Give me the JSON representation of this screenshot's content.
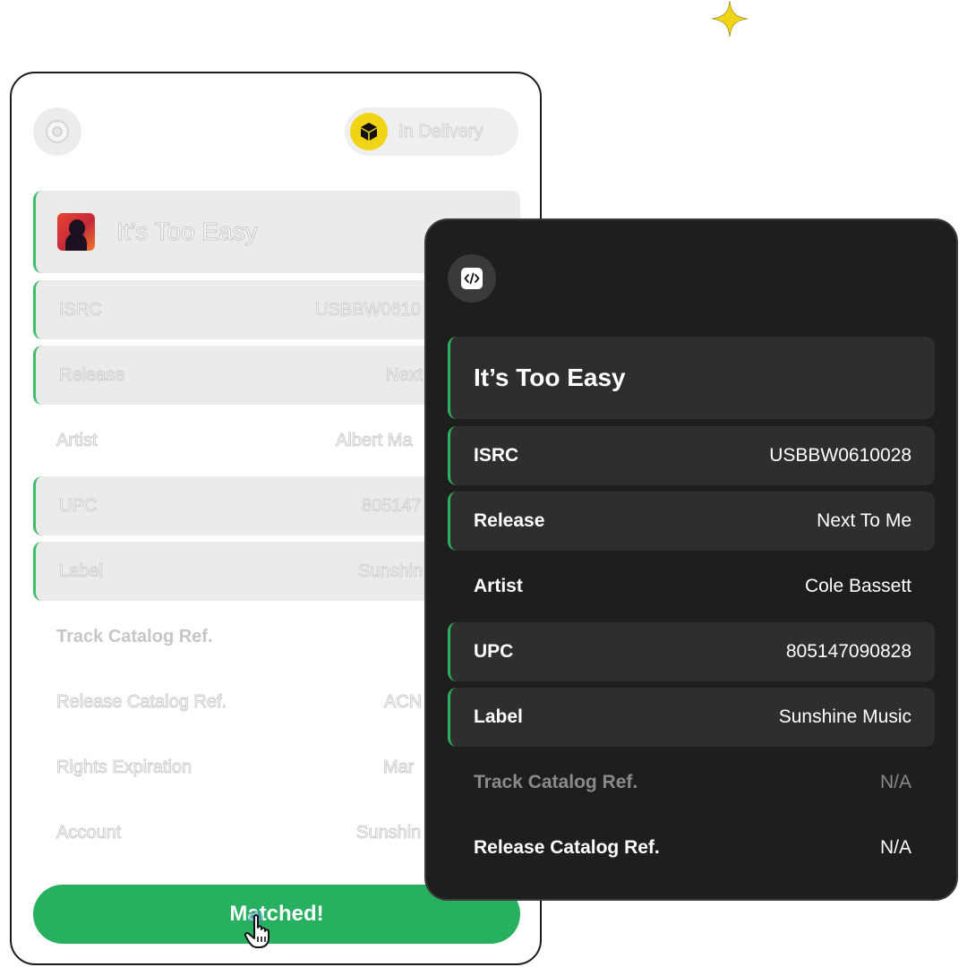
{
  "status": {
    "label": "In Delivery"
  },
  "track": {
    "title": "It’s Too Easy"
  },
  "light_card": {
    "rows": [
      {
        "key": "ISRC",
        "value": "USBBW0610"
      },
      {
        "key": "Release",
        "value": "Next"
      },
      {
        "key": "Artist",
        "value": "Albert Ma"
      },
      {
        "key": "UPC",
        "value": "805147"
      },
      {
        "key": "Label",
        "value": "Sunshin"
      },
      {
        "key": "Track Catalog Ref.",
        "value": ""
      },
      {
        "key": "Release Catalog Ref.",
        "value": "ACN"
      },
      {
        "key": "Rights Expiration",
        "value": "Mar"
      },
      {
        "key": "Account",
        "value": "Sunshin"
      }
    ],
    "button_label": "Matched!"
  },
  "dark_card": {
    "rows": [
      {
        "key": "ISRC",
        "value": "USBBW0610028"
      },
      {
        "key": "Release",
        "value": "Next To Me"
      },
      {
        "key": "Artist",
        "value": "Cole Bassett"
      },
      {
        "key": "UPC",
        "value": "805147090828"
      },
      {
        "key": "Label",
        "value": "Sunshine Music"
      },
      {
        "key": "Track Catalog Ref.",
        "value": "N/A"
      },
      {
        "key": "Release Catalog Ref.",
        "value": "N/A"
      }
    ]
  },
  "icons": {
    "sparkle": "sparkle-icon",
    "disc": "disc-icon",
    "status": "package-icon",
    "code": "code-icon",
    "cursor": "hand-pointer-icon"
  },
  "colors": {
    "accent_green": "#26b060",
    "status_yellow": "#f2d416",
    "sparkle_yellow": "#f2d416",
    "dark_bg": "#1e1e1e",
    "dark_row": "#2e2e2e",
    "light_row": "#ebebeb"
  }
}
